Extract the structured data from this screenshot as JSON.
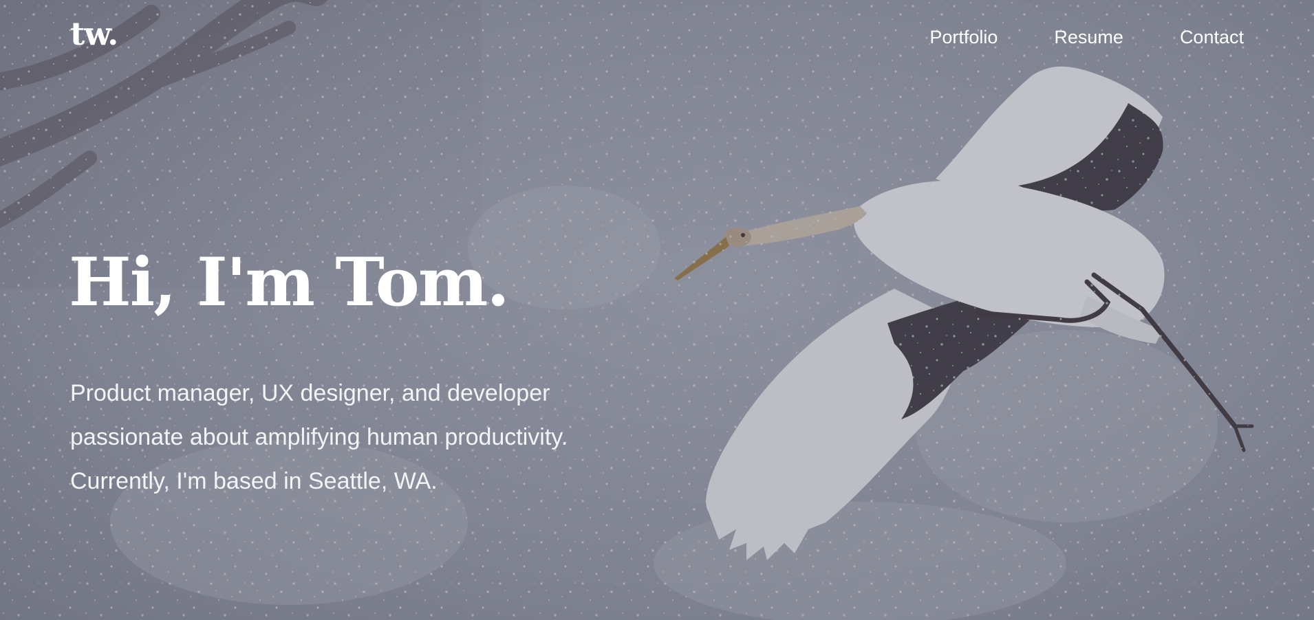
{
  "brand": {
    "logo_text": "tw."
  },
  "nav": {
    "items": [
      {
        "label": "Portfolio"
      },
      {
        "label": "Resume"
      },
      {
        "label": "Contact"
      }
    ]
  },
  "hero": {
    "headline": "Hi, I'm Tom.",
    "intro_lines": [
      "Product manager, UX designer, and developer",
      "passionate about amplifying human productivity.",
      "Currently, I'm based in Seattle, WA."
    ],
    "background_image": "crane-flying-in-snow"
  },
  "colors": {
    "text": "#ffffff",
    "overlay": "#8f93a0"
  }
}
